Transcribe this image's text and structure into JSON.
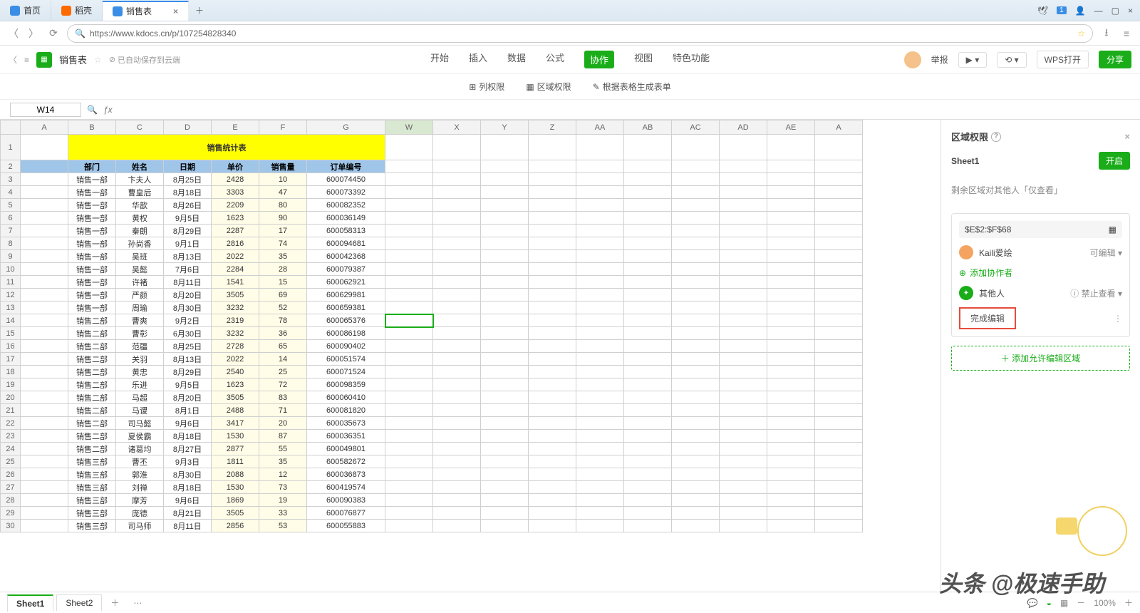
{
  "titlebar": {
    "tabs": [
      {
        "label": "首页",
        "color": "#3a8ee6"
      },
      {
        "label": "稻壳",
        "color": "#ff6a00"
      },
      {
        "label": "销售表",
        "color": "#3a8ee6",
        "current": true
      }
    ],
    "badge": "1"
  },
  "address": {
    "url": "https://www.kdocs.cn/p/107254828340"
  },
  "doc": {
    "title": "销售表",
    "saved": "已自动保存到云端",
    "menu": [
      "开始",
      "插入",
      "数据",
      "公式",
      "协作",
      "视图",
      "特色功能"
    ],
    "active_menu": 4,
    "report": "举报",
    "open_wps": "WPS打开",
    "share": "分享"
  },
  "toolbar": {
    "col_perm": "列权限",
    "area_perm": "区域权限",
    "gen_form": "根据表格生成表单"
  },
  "formula": {
    "cellref": "W14"
  },
  "columns_visible": [
    "A",
    "B",
    "C",
    "D",
    "E",
    "F",
    "G",
    "W",
    "X",
    "Y",
    "Z",
    "AA",
    "AB",
    "AC",
    "AD",
    "AE",
    "A"
  ],
  "sel_col": "W",
  "sel_row": 14,
  "sheet": {
    "title": "销售统计表",
    "headers": [
      "部门",
      "姓名",
      "日期",
      "单价",
      "销售量",
      "订单编号"
    ],
    "rows": [
      [
        "销售一部",
        "卞夫人",
        "8月25日",
        "2428",
        "10",
        "600074450"
      ],
      [
        "销售一部",
        "曹皇后",
        "8月18日",
        "3303",
        "47",
        "600073392"
      ],
      [
        "销售一部",
        "华歆",
        "8月26日",
        "2209",
        "80",
        "600082352"
      ],
      [
        "销售一部",
        "黄权",
        "9月5日",
        "1623",
        "90",
        "600036149"
      ],
      [
        "销售一部",
        "秦朗",
        "8月29日",
        "2287",
        "17",
        "600058313"
      ],
      [
        "销售一部",
        "孙尚香",
        "9月1日",
        "2816",
        "74",
        "600094681"
      ],
      [
        "销售一部",
        "吴班",
        "8月13日",
        "2022",
        "35",
        "600042368"
      ],
      [
        "销售一部",
        "吴懿",
        "7月6日",
        "2284",
        "28",
        "600079387"
      ],
      [
        "销售一部",
        "许褚",
        "8月11日",
        "1541",
        "15",
        "600062921"
      ],
      [
        "销售一部",
        "严颜",
        "8月20日",
        "3505",
        "69",
        "600629981"
      ],
      [
        "销售一部",
        "周瑜",
        "8月30日",
        "3232",
        "52",
        "600659381"
      ],
      [
        "销售二部",
        "曹爽",
        "9月2日",
        "2319",
        "78",
        "600065376"
      ],
      [
        "销售二部",
        "曹彰",
        "6月30日",
        "3232",
        "36",
        "600086198"
      ],
      [
        "销售二部",
        "范疆",
        "8月25日",
        "2728",
        "65",
        "600090402"
      ],
      [
        "销售二部",
        "关羽",
        "8月13日",
        "2022",
        "14",
        "600051574"
      ],
      [
        "销售二部",
        "黄忠",
        "8月29日",
        "2540",
        "25",
        "600071524"
      ],
      [
        "销售二部",
        "乐进",
        "9月5日",
        "1623",
        "72",
        "600098359"
      ],
      [
        "销售二部",
        "马超",
        "8月20日",
        "3505",
        "83",
        "600060410"
      ],
      [
        "销售二部",
        "马谡",
        "8月1日",
        "2488",
        "71",
        "600081820"
      ],
      [
        "销售二部",
        "司马懿",
        "9月6日",
        "3417",
        "20",
        "600035673"
      ],
      [
        "销售二部",
        "夏侯霸",
        "8月18日",
        "1530",
        "87",
        "600036351"
      ],
      [
        "销售二部",
        "诸葛均",
        "8月27日",
        "2877",
        "55",
        "600049801"
      ],
      [
        "销售三部",
        "曹丕",
        "9月3日",
        "1811",
        "35",
        "600582672"
      ],
      [
        "销售三部",
        "郭淮",
        "8月30日",
        "2088",
        "12",
        "600036873"
      ],
      [
        "销售三部",
        "刘禅",
        "8月18日",
        "1530",
        "73",
        "600419574"
      ],
      [
        "销售三部",
        "摩芳",
        "9月6日",
        "1869",
        "19",
        "600090383"
      ],
      [
        "销售三部",
        "庞德",
        "8月21日",
        "3505",
        "33",
        "600076877"
      ],
      [
        "销售三部",
        "司马师",
        "8月11日",
        "2856",
        "53",
        "600055883"
      ]
    ]
  },
  "panel": {
    "title": "区域权限",
    "sheet_name": "Sheet1",
    "enable": "开启",
    "note": "剩余区域对其他人「仅查看」",
    "range": "$E$2:$F$68",
    "editor_name": "Kaili爱绘",
    "editor_perm": "可编辑",
    "add_collab": "添加协作者",
    "others": "其他人",
    "others_perm": "禁止查看",
    "finish": "完成编辑",
    "add_region": "添加允许编辑区域"
  },
  "sheets": {
    "tabs": [
      "Sheet1",
      "Sheet2"
    ],
    "active": 0,
    "zoom": "100%"
  },
  "watermark": "头条 @极速手助"
}
